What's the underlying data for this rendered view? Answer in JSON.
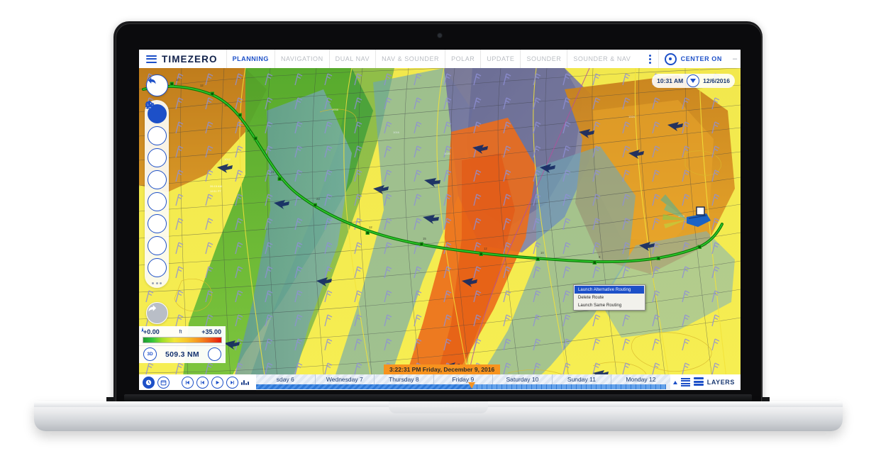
{
  "app": {
    "brand": "TIMEZERO",
    "menu_icon": "hamburger-icon"
  },
  "tabs": [
    {
      "label": "PLANNING",
      "active": true
    },
    {
      "label": "NAVIGATION",
      "active": false
    },
    {
      "label": "DUAL NAV",
      "active": false
    },
    {
      "label": "NAV & SOUNDER",
      "active": false
    },
    {
      "label": "POLAR",
      "active": false
    },
    {
      "label": "UPDATE",
      "active": false
    },
    {
      "label": "SOUNDER",
      "active": false
    },
    {
      "label": "SOUNDER & NAV",
      "active": false
    }
  ],
  "topright": {
    "center_on": "CENTER ON",
    "minimize": "–"
  },
  "date_widget": {
    "time": "10:31 AM",
    "date": "12/6/2016"
  },
  "left_toolbar": {
    "back": "back-arrow-icon",
    "forward": "forward-arrow-icon",
    "tools": [
      {
        "name": "pan-hand-icon",
        "active": true
      },
      {
        "name": "zoom-in-icon",
        "active": false
      },
      {
        "name": "zoom-out-icon",
        "active": false
      },
      {
        "name": "divider-compass-icon",
        "active": false
      },
      {
        "name": "buoy-marker-icon",
        "active": false
      },
      {
        "name": "route-icon",
        "active": false
      },
      {
        "name": "measure-icon",
        "active": false
      },
      {
        "name": "polygon-icon",
        "active": false
      }
    ],
    "more": "more-dots-icon"
  },
  "legend": {
    "min": "+0.00",
    "unit": "ft",
    "max": "+35.00",
    "distance": "509.3 NM",
    "mode_badge": "3D",
    "north_badge": "north-up-icon"
  },
  "context_menu": {
    "items": [
      {
        "label": "Launch Alternative Routing",
        "selected": true
      },
      {
        "label": "Delete Route",
        "selected": false
      },
      {
        "label": "Launch Same Routing",
        "selected": false
      }
    ]
  },
  "time_banner": "3:22:31 PM Friday, December 9, 2016",
  "timeline": {
    "days": [
      "sday 6",
      "Wednesday 7",
      "Thursday 8",
      "Friday 9",
      "Saturday 10",
      "Sunday 11",
      "Monday 12"
    ],
    "playback": [
      {
        "name": "clock-icon",
        "filled": true
      },
      {
        "name": "calendar-icon",
        "filled": false
      },
      {
        "name": "skip-start-icon",
        "filled": false
      },
      {
        "name": "step-back-icon",
        "filled": false
      },
      {
        "name": "play-icon",
        "filled": false
      },
      {
        "name": "step-forward-icon",
        "filled": false
      }
    ]
  },
  "layers": {
    "label": "LAYERS",
    "list_icon": "list-icon",
    "stack_icon": "layers-stack-icon",
    "expand_icon": "triangle-up-icon"
  },
  "colors": {
    "brand_blue": "#1d50c8",
    "deep_blue": "#11214a",
    "accent_orange": "#f7931e",
    "route_green": "#16a010",
    "sea_yellow": "#f6ee52"
  }
}
